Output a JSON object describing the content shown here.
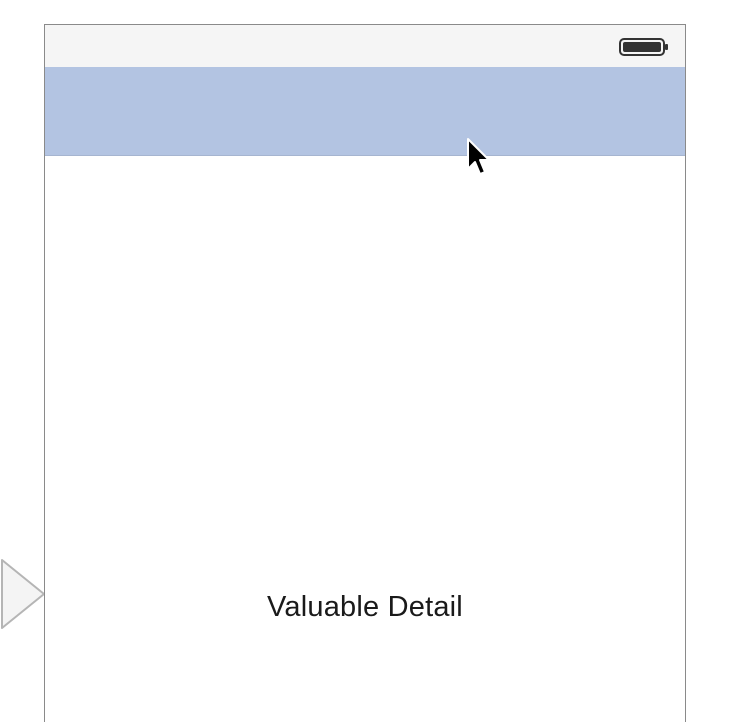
{
  "scene": {
    "detail_label": "Valuable Detail"
  },
  "icons": {
    "battery": "battery-icon",
    "cursor": "mouse-pointer-icon",
    "segue": "segue-arrow-icon"
  },
  "colors": {
    "nav_bar": "#b3c4e2",
    "status_bar": "#f5f5f5",
    "device_border": "#8a8a8a"
  }
}
